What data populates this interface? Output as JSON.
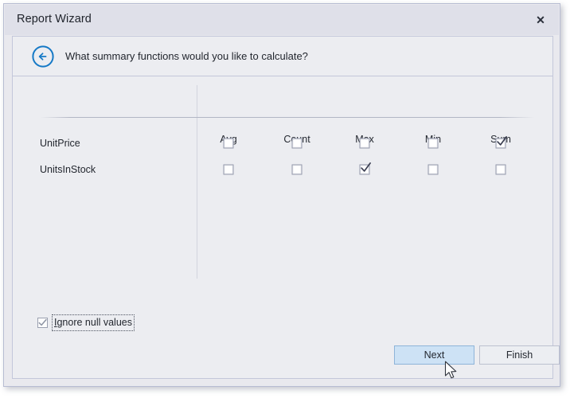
{
  "window": {
    "title": "Report Wizard",
    "close_label": "✕",
    "close_icon": "close-icon"
  },
  "header": {
    "back_icon": "back-circle-arrow-icon",
    "question": "What summary functions would you like to calculate?"
  },
  "grid": {
    "columns": [
      "Avg",
      "Count",
      "Max",
      "Min",
      "Sum"
    ],
    "rows": [
      {
        "label": "UnitPrice",
        "checks": [
          false,
          false,
          false,
          false,
          true
        ]
      },
      {
        "label": "UnitsInStock",
        "checks": [
          false,
          false,
          true,
          false,
          false
        ]
      }
    ]
  },
  "options": {
    "ignore_null": {
      "label": "Ignore null values",
      "label_mnemonic": "I",
      "label_rest": "gnore null values",
      "checked": true
    }
  },
  "buttons": {
    "next": "Next",
    "finish": "Finish"
  },
  "colors": {
    "accent": "#1579c6",
    "title_bar": "#dfe0e9",
    "panel": "#ecedf1",
    "button_highlight": "#cde2f5",
    "border": "#c3c7da"
  }
}
